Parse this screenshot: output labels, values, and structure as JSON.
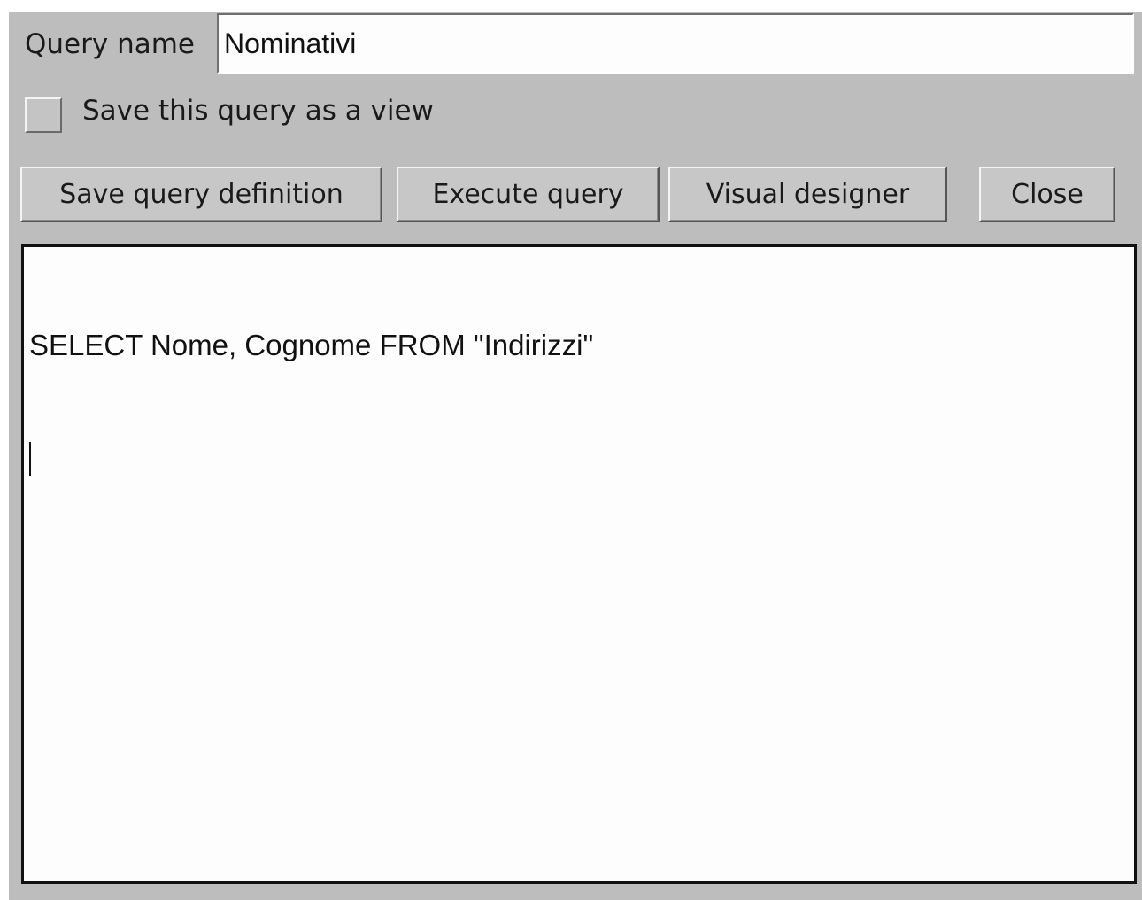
{
  "form": {
    "query_name_label": "Query name",
    "query_name_value": "Nominativi",
    "save_as_view_label": "Save this query as a view",
    "save_as_view_checked": false
  },
  "buttons": {
    "save_definition": "Save query definition",
    "execute": "Execute query",
    "visual_designer": "Visual designer",
    "close": "Close"
  },
  "editor": {
    "sql_text": "SELECT Nome, Cognome FROM \"Indirizzi\""
  }
}
